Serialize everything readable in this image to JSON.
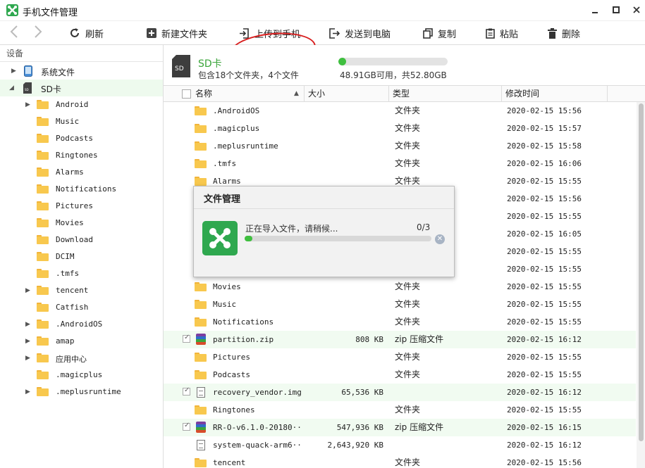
{
  "window": {
    "title": "手机文件管理"
  },
  "toolbar": {
    "refresh": "刷新",
    "new_folder": "新建文件夹",
    "upload": "上传到手机",
    "send_to_pc": "发送到电脑",
    "copy": "复制",
    "paste": "粘贴",
    "delete": "删除"
  },
  "sidebar": {
    "header": "设备",
    "system_files": "系统文件",
    "sd_card": "SD卡",
    "folders": [
      "Android",
      "Music",
      "Podcasts",
      "Ringtones",
      "Alarms",
      "Notifications",
      "Pictures",
      "Movies",
      "Download",
      "DCIM",
      ".tmfs",
      "tencent",
      "Catfish",
      ".AndroidOS",
      "amap",
      "应用中心",
      ".magicplus",
      ".meplusruntime"
    ],
    "expandable": [
      true,
      false,
      false,
      false,
      false,
      false,
      false,
      false,
      false,
      false,
      false,
      true,
      false,
      true,
      true,
      true,
      false,
      true
    ]
  },
  "info": {
    "title": "SD卡",
    "subtitle": "包含18个文件夹，4个文件",
    "storage_text": "48.91GB可用，共52.80GB",
    "storage_used_fraction": 0.074
  },
  "table": {
    "columns": {
      "name": "名称",
      "size": "大小",
      "type": "类型",
      "modified": "修改时间"
    },
    "rows": [
      {
        "name": ".AndroidOS",
        "size": "",
        "type": "文件夹",
        "modified": "2020-02-15 15:56",
        "icon": "folder",
        "checked": false
      },
      {
        "name": ".magicplus",
        "size": "",
        "type": "文件夹",
        "modified": "2020-02-15 15:57",
        "icon": "folder",
        "checked": false
      },
      {
        "name": ".meplusruntime",
        "size": "",
        "type": "文件夹",
        "modified": "2020-02-15 15:58",
        "icon": "folder",
        "checked": false
      },
      {
        "name": ".tmfs",
        "size": "",
        "type": "文件夹",
        "modified": "2020-02-15 16:06",
        "icon": "folder",
        "checked": false
      },
      {
        "name": "Alarms",
        "size": "",
        "type": "文件夹",
        "modified": "2020-02-15 15:55",
        "icon": "folder",
        "checked": false
      },
      {
        "name": "",
        "size": "",
        "type": "",
        "modified": "2020-02-15 15:56",
        "icon": "folder",
        "checked": false
      },
      {
        "name": "",
        "size": "",
        "type": "",
        "modified": "2020-02-15 15:55",
        "icon": "folder",
        "checked": false
      },
      {
        "name": "",
        "size": "",
        "type": "",
        "modified": "2020-02-15 16:05",
        "icon": "folder",
        "checked": false
      },
      {
        "name": "",
        "size": "",
        "type": "",
        "modified": "2020-02-15 15:55",
        "icon": "folder",
        "checked": false
      },
      {
        "name": "",
        "size": "",
        "type": "",
        "modified": "2020-02-15 15:55",
        "icon": "folder",
        "checked": false
      },
      {
        "name": "Movies",
        "size": "",
        "type": "文件夹",
        "modified": "2020-02-15 15:55",
        "icon": "folder",
        "checked": false
      },
      {
        "name": "Music",
        "size": "",
        "type": "文件夹",
        "modified": "2020-02-15 15:55",
        "icon": "folder",
        "checked": false
      },
      {
        "name": "Notifications",
        "size": "",
        "type": "文件夹",
        "modified": "2020-02-15 15:55",
        "icon": "folder",
        "checked": false
      },
      {
        "name": "partition.zip",
        "size": "808 KB",
        "type": "zip 压缩文件",
        "modified": "2020-02-15 16:12",
        "icon": "zip",
        "checked": true
      },
      {
        "name": "Pictures",
        "size": "",
        "type": "文件夹",
        "modified": "2020-02-15 15:55",
        "icon": "folder",
        "checked": false
      },
      {
        "name": "Podcasts",
        "size": "",
        "type": "文件夹",
        "modified": "2020-02-15 15:55",
        "icon": "folder",
        "checked": false
      },
      {
        "name": "recovery_vendor.img",
        "size": "65,536 KB",
        "type": "",
        "modified": "2020-02-15 16:12",
        "icon": "doc",
        "checked": true
      },
      {
        "name": "Ringtones",
        "size": "",
        "type": "文件夹",
        "modified": "2020-02-15 15:55",
        "icon": "folder",
        "checked": false
      },
      {
        "name": "RR-O-v6.1.0-20180···",
        "size": "547,936 KB",
        "type": "zip 压缩文件",
        "modified": "2020-02-15 16:15",
        "icon": "zip",
        "checked": true
      },
      {
        "name": "system-quack-arm6···",
        "size": "2,643,920 KB",
        "type": "",
        "modified": "2020-02-15 16:12",
        "icon": "doc",
        "checked": false
      },
      {
        "name": "tencent",
        "size": "",
        "type": "文件夹",
        "modified": "2020-02-15 15:56",
        "icon": "folder",
        "checked": false
      }
    ]
  },
  "dialog": {
    "title": "文件管理",
    "message": "正在导入文件，请稍候...",
    "count": "0/3",
    "progress_fraction": 0.04
  },
  "colors": {
    "accent": "#3aa53a",
    "progress": "#3fbf3f",
    "annotation": "#d81e1e"
  }
}
